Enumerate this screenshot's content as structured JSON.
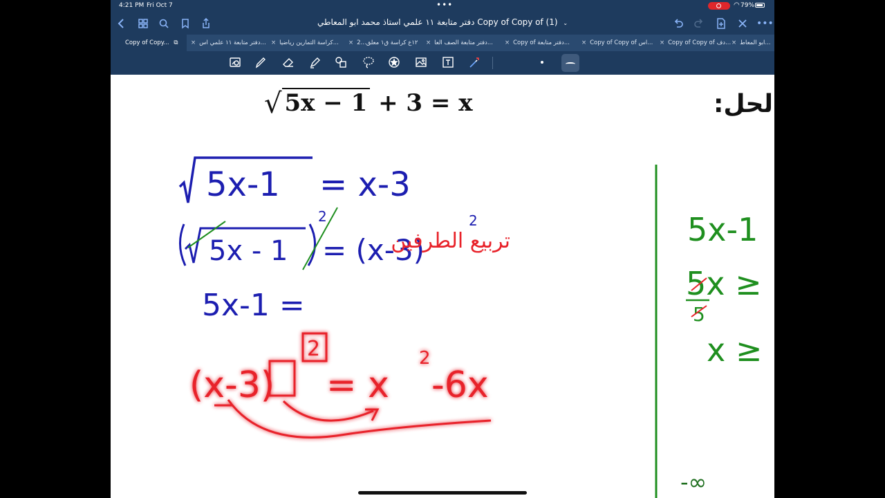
{
  "status_bar": {
    "time": "4:21 PM",
    "date": "Fri Oct 7",
    "battery": "79%"
  },
  "nav": {
    "title": "دفتر متابعة ١١ علمي استاذ محمد ابو المعاطي Copy of Copy of (1)"
  },
  "tabs": [
    {
      "label": "Copy of Copy...",
      "active": true
    },
    {
      "label": "دفتر متابعة ١١ علمي اس..."
    },
    {
      "label": "كراسة التمارين رياضيا..."
    },
    {
      "label": "١٢ع كراسة ق١ معلق...2"
    },
    {
      "label": "دفتر متابعة الصف العا..."
    },
    {
      "label": "Copy of دفتر متابعة..."
    },
    {
      "label": "Copy of Copy of اس..."
    },
    {
      "label": "Copy of Copy of دف..."
    },
    {
      "label": "ابو المعاط..."
    }
  ],
  "toolbar": {
    "tools": [
      "screenshot-icon",
      "pen-icon",
      "eraser-icon",
      "highlighter-icon",
      "shapes-icon",
      "lasso-icon",
      "elements-icon",
      "image-icon",
      "text-icon",
      "laser-pointer-icon"
    ]
  },
  "page": {
    "problem": {
      "radicand": "5x − 1",
      "rest": "+ 3 = x"
    },
    "solution_label": "الحل:",
    "blue": {
      "line1_radicand": "5x-1",
      "line1_rhs": "= x-3",
      "line2_radicand": "5x - 1",
      "line2_rhs": "= (x-3)",
      "line2_exp_left": "2",
      "line2_exp_right": "2",
      "line3": "5x-1 ="
    },
    "red": {
      "note": "تربيع الطرفين",
      "expr_lhs": "(x-3)",
      "expr_exp": "2",
      "expr_rhs": "= x",
      "expr_rhs_exp": "2",
      "expr_rhs_tail": "-6x"
    },
    "green": {
      "line1": "5x-1",
      "line2": "5x ≥",
      "line2_div": "5",
      "line3": "x ≥",
      "neg_inf": "-∞"
    }
  }
}
